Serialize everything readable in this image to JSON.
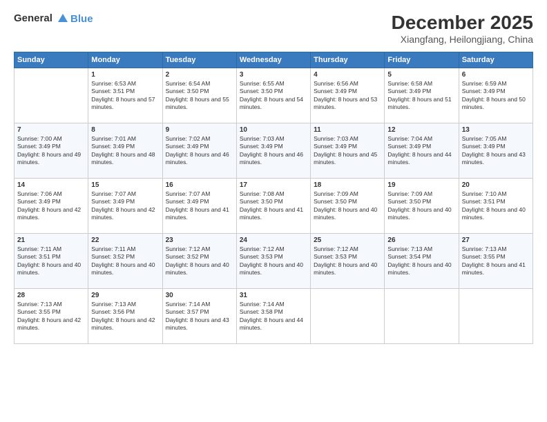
{
  "header": {
    "logo_line1": "General",
    "logo_line2": "Blue",
    "title": "December 2025",
    "subtitle": "Xiangfang, Heilongjiang, China"
  },
  "days_of_week": [
    "Sunday",
    "Monday",
    "Tuesday",
    "Wednesday",
    "Thursday",
    "Friday",
    "Saturday"
  ],
  "weeks": [
    [
      {
        "day": "",
        "sunrise": "",
        "sunset": "",
        "daylight": ""
      },
      {
        "day": "1",
        "sunrise": "Sunrise: 6:53 AM",
        "sunset": "Sunset: 3:51 PM",
        "daylight": "Daylight: 8 hours and 57 minutes."
      },
      {
        "day": "2",
        "sunrise": "Sunrise: 6:54 AM",
        "sunset": "Sunset: 3:50 PM",
        "daylight": "Daylight: 8 hours and 55 minutes."
      },
      {
        "day": "3",
        "sunrise": "Sunrise: 6:55 AM",
        "sunset": "Sunset: 3:50 PM",
        "daylight": "Daylight: 8 hours and 54 minutes."
      },
      {
        "day": "4",
        "sunrise": "Sunrise: 6:56 AM",
        "sunset": "Sunset: 3:49 PM",
        "daylight": "Daylight: 8 hours and 53 minutes."
      },
      {
        "day": "5",
        "sunrise": "Sunrise: 6:58 AM",
        "sunset": "Sunset: 3:49 PM",
        "daylight": "Daylight: 8 hours and 51 minutes."
      },
      {
        "day": "6",
        "sunrise": "Sunrise: 6:59 AM",
        "sunset": "Sunset: 3:49 PM",
        "daylight": "Daylight: 8 hours and 50 minutes."
      }
    ],
    [
      {
        "day": "7",
        "sunrise": "Sunrise: 7:00 AM",
        "sunset": "Sunset: 3:49 PM",
        "daylight": "Daylight: 8 hours and 49 minutes."
      },
      {
        "day": "8",
        "sunrise": "Sunrise: 7:01 AM",
        "sunset": "Sunset: 3:49 PM",
        "daylight": "Daylight: 8 hours and 48 minutes."
      },
      {
        "day": "9",
        "sunrise": "Sunrise: 7:02 AM",
        "sunset": "Sunset: 3:49 PM",
        "daylight": "Daylight: 8 hours and 46 minutes."
      },
      {
        "day": "10",
        "sunrise": "Sunrise: 7:03 AM",
        "sunset": "Sunset: 3:49 PM",
        "daylight": "Daylight: 8 hours and 46 minutes."
      },
      {
        "day": "11",
        "sunrise": "Sunrise: 7:03 AM",
        "sunset": "Sunset: 3:49 PM",
        "daylight": "Daylight: 8 hours and 45 minutes."
      },
      {
        "day": "12",
        "sunrise": "Sunrise: 7:04 AM",
        "sunset": "Sunset: 3:49 PM",
        "daylight": "Daylight: 8 hours and 44 minutes."
      },
      {
        "day": "13",
        "sunrise": "Sunrise: 7:05 AM",
        "sunset": "Sunset: 3:49 PM",
        "daylight": "Daylight: 8 hours and 43 minutes."
      }
    ],
    [
      {
        "day": "14",
        "sunrise": "Sunrise: 7:06 AM",
        "sunset": "Sunset: 3:49 PM",
        "daylight": "Daylight: 8 hours and 42 minutes."
      },
      {
        "day": "15",
        "sunrise": "Sunrise: 7:07 AM",
        "sunset": "Sunset: 3:49 PM",
        "daylight": "Daylight: 8 hours and 42 minutes."
      },
      {
        "day": "16",
        "sunrise": "Sunrise: 7:07 AM",
        "sunset": "Sunset: 3:49 PM",
        "daylight": "Daylight: 8 hours and 41 minutes."
      },
      {
        "day": "17",
        "sunrise": "Sunrise: 7:08 AM",
        "sunset": "Sunset: 3:50 PM",
        "daylight": "Daylight: 8 hours and 41 minutes."
      },
      {
        "day": "18",
        "sunrise": "Sunrise: 7:09 AM",
        "sunset": "Sunset: 3:50 PM",
        "daylight": "Daylight: 8 hours and 40 minutes."
      },
      {
        "day": "19",
        "sunrise": "Sunrise: 7:09 AM",
        "sunset": "Sunset: 3:50 PM",
        "daylight": "Daylight: 8 hours and 40 minutes."
      },
      {
        "day": "20",
        "sunrise": "Sunrise: 7:10 AM",
        "sunset": "Sunset: 3:51 PM",
        "daylight": "Daylight: 8 hours and 40 minutes."
      }
    ],
    [
      {
        "day": "21",
        "sunrise": "Sunrise: 7:11 AM",
        "sunset": "Sunset: 3:51 PM",
        "daylight": "Daylight: 8 hours and 40 minutes."
      },
      {
        "day": "22",
        "sunrise": "Sunrise: 7:11 AM",
        "sunset": "Sunset: 3:52 PM",
        "daylight": "Daylight: 8 hours and 40 minutes."
      },
      {
        "day": "23",
        "sunrise": "Sunrise: 7:12 AM",
        "sunset": "Sunset: 3:52 PM",
        "daylight": "Daylight: 8 hours and 40 minutes."
      },
      {
        "day": "24",
        "sunrise": "Sunrise: 7:12 AM",
        "sunset": "Sunset: 3:53 PM",
        "daylight": "Daylight: 8 hours and 40 minutes."
      },
      {
        "day": "25",
        "sunrise": "Sunrise: 7:12 AM",
        "sunset": "Sunset: 3:53 PM",
        "daylight": "Daylight: 8 hours and 40 minutes."
      },
      {
        "day": "26",
        "sunrise": "Sunrise: 7:13 AM",
        "sunset": "Sunset: 3:54 PM",
        "daylight": "Daylight: 8 hours and 40 minutes."
      },
      {
        "day": "27",
        "sunrise": "Sunrise: 7:13 AM",
        "sunset": "Sunset: 3:55 PM",
        "daylight": "Daylight: 8 hours and 41 minutes."
      }
    ],
    [
      {
        "day": "28",
        "sunrise": "Sunrise: 7:13 AM",
        "sunset": "Sunset: 3:55 PM",
        "daylight": "Daylight: 8 hours and 42 minutes."
      },
      {
        "day": "29",
        "sunrise": "Sunrise: 7:13 AM",
        "sunset": "Sunset: 3:56 PM",
        "daylight": "Daylight: 8 hours and 42 minutes."
      },
      {
        "day": "30",
        "sunrise": "Sunrise: 7:14 AM",
        "sunset": "Sunset: 3:57 PM",
        "daylight": "Daylight: 8 hours and 43 minutes."
      },
      {
        "day": "31",
        "sunrise": "Sunrise: 7:14 AM",
        "sunset": "Sunset: 3:58 PM",
        "daylight": "Daylight: 8 hours and 44 minutes."
      },
      {
        "day": "",
        "sunrise": "",
        "sunset": "",
        "daylight": ""
      },
      {
        "day": "",
        "sunrise": "",
        "sunset": "",
        "daylight": ""
      },
      {
        "day": "",
        "sunrise": "",
        "sunset": "",
        "daylight": ""
      }
    ]
  ]
}
